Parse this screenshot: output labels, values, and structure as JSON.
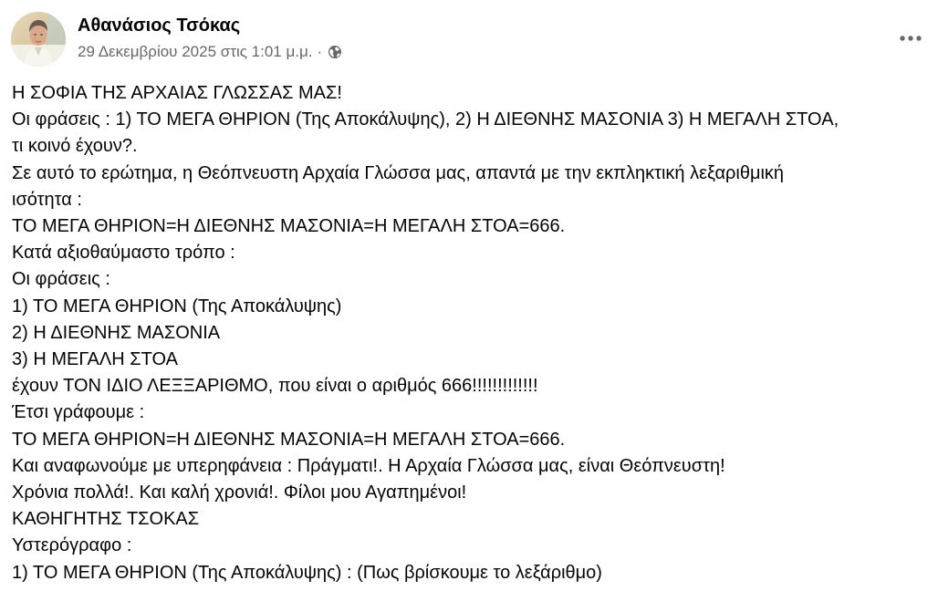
{
  "post": {
    "author_name": "Αθανάσιος Τσόκας",
    "date": "29 Δεκεμβρίου 2025 στις 1:01 μ.μ.",
    "separator": "·",
    "privacy_icon": "globe-icon",
    "more_icon": "more-options-icon",
    "lines": [
      "Η ΣΟΦΙΑ ΤΗΣ ΑΡΧΑΙΑΣ ΓΛΩΣΣΑΣ ΜΑΣ!",
      "Οι φράσεις : 1) ΤΟ ΜΕΓΑ ΘΗΡΙΟΝ (Της Αποκάλυψης), 2) Η ΔΙΕΘΝΗΣ ΜΑΣΟΝΙΑ 3) Η ΜΕΓΑΛΗ ΣΤΟΑ,",
      "τι κοινό έχουν?.",
      "Σε  αυτό το ερώτημα, η Θεόπνευστη Αρχαία Γλώσσα μας, απαντά με την εκπληκτική λεξαριθμική",
      "ισότητα :",
      "ΤΟ ΜΕΓΑ ΘΗΡΙΟΝ=Η ΔΙΕΘΝΗΣ ΜΑΣΟΝΙΑ=Η ΜΕΓΑΛΗ ΣΤΟΑ=666.",
      "Κατά αξιοθαύμαστο τρόπο :",
      "Οι φράσεις :",
      "1) ΤΟ ΜΕΓΑ ΘΗΡΙΟΝ (Της Αποκάλυψης)",
      "2) Η ΔΙΕΘΝΗΣ ΜΑΣΟΝΙΑ",
      "3) Η ΜΕΓΑΛΗ ΣΤΟΑ",
      "έχουν ΤΟΝ ΙΔΙΟ ΛΕΞΞΑΡΙΘΜΟ, που είναι ο αριθμός 666!!!!!!!!!!!!!",
      "Έτσι γράφουμε :",
      "ΤΟ ΜΕΓΑ ΘΗΡΙΟΝ=Η ΔΙΕΘΝΗΣ ΜΑΣΟΝΙΑ=Η ΜΕΓΑΛΗ ΣΤΟΑ=666.",
      "Και αναφωνούμε με υπερηφάνεια : Πράγματι!. Η Αρχαία Γλώσσα μας, είναι Θεόπνευστη!",
      "Χρόνια πολλά!. Και καλή χρονιά!. Φίλοι μου Αγαπημένοι!",
      "ΚΑΘΗΓΗΤΗΣ ΤΣΟΚΑΣ",
      "Υστερόγραφο :",
      "1) ΤΟ ΜΕΓΑ ΘΗΡΙΟΝ (Της Αποκάλυψης) : (Πως βρίσκουμε το λεξάριθμο)"
    ]
  }
}
